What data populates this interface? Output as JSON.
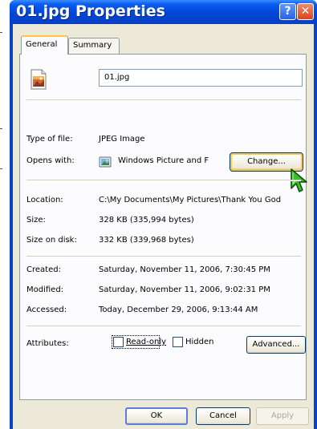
{
  "window": {
    "title": "01.jpg Properties",
    "help_symbol": "?",
    "close_symbol": "✕"
  },
  "tabs": [
    {
      "label": "General",
      "active": true
    },
    {
      "label": "Summary",
      "active": false
    }
  ],
  "file": {
    "name": "01.jpg",
    "icon": "jpeg-file-icon"
  },
  "properties": {
    "type_label": "Type of file:",
    "type_value": "JPEG Image",
    "opens_label": "Opens with:",
    "opens_value": "Windows Picture and F",
    "opens_icon": "windows-picture-viewer-icon",
    "change_button": "Change...",
    "location_label": "Location:",
    "location_value": "C:\\My Documents\\My Pictures\\Thank You God",
    "size_label": "Size:",
    "size_value": "328 KB (335,994 bytes)",
    "size_on_disk_label": "Size on disk:",
    "size_on_disk_value": "332 KB (339,968 bytes)",
    "created_label": "Created:",
    "created_value": "Saturday, November 11, 2006, 7:30:45 PM",
    "modified_label": "Modified:",
    "modified_value": "Saturday, November 11, 2006, 9:02:31 PM",
    "accessed_label": "Accessed:",
    "accessed_value": "Today, December 29, 2006, 9:13:44 AM",
    "attributes_label": "Attributes:",
    "readonly_label": "Read-only",
    "readonly_checked": false,
    "hidden_label": "Hidden",
    "hidden_checked": false,
    "advanced_button": "Advanced..."
  },
  "footer": {
    "ok": "OK",
    "cancel": "Cancel",
    "apply": "Apply"
  },
  "colors": {
    "titlebar": "#0046d8",
    "dialog_face": "#ece9d8",
    "tab_highlight": "#ffc83c",
    "cursor": "#3cbf2a"
  }
}
